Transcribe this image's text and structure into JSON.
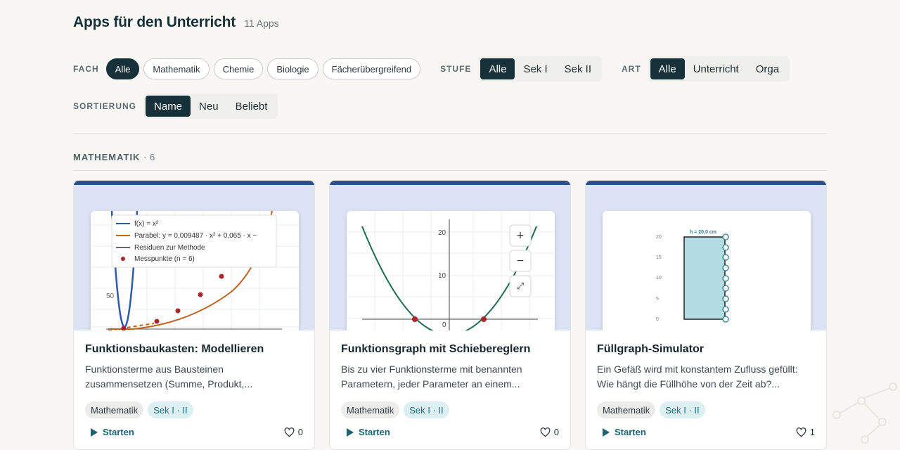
{
  "header": {
    "title": "Apps für den Unterricht",
    "count": "11 Apps"
  },
  "filters": {
    "fach": {
      "label": "FACH",
      "options": [
        "Alle",
        "Mathematik",
        "Chemie",
        "Biologie",
        "Fächerübergreifend"
      ],
      "selected": "Alle"
    },
    "stufe": {
      "label": "STUFE",
      "options": [
        "Alle",
        "Sek I",
        "Sek II"
      ],
      "selected": "Alle"
    },
    "art": {
      "label": "ART",
      "options": [
        "Alle",
        "Unterricht",
        "Orga"
      ],
      "selected": "Alle"
    },
    "sortierung": {
      "label": "SORTIERUNG",
      "options": [
        "Name",
        "Neu",
        "Beliebt"
      ],
      "selected": "Name"
    }
  },
  "section": {
    "title": "MATHEMATIK",
    "count": "· 6"
  },
  "cards": [
    {
      "title": "Funktionsbaukasten: Modellieren",
      "desc": "Funktionsterme aus Bausteinen zusammensetzen (Summe, Produkt,...",
      "subject": "Mathematik",
      "level": "Sek I · II",
      "start": "Starten",
      "likes": "0",
      "preview": {
        "legend": [
          "f(x) = x²",
          "Parabel: y = 0,009487 · x² + 0,065 · x −",
          "Residuen zur Methode",
          "Messpunkte (n = 6)"
        ],
        "y_tick": "50"
      }
    },
    {
      "title": "Funktionsgraph mit Schiebereglern",
      "desc": "Bis zu vier Funktionsterme mit benannten Parametern, jeder Parameter an einem...",
      "subject": "Mathematik",
      "level": "Sek I · II",
      "start": "Starten",
      "likes": "0",
      "preview": {
        "y_ticks": [
          "20",
          "10",
          "0"
        ],
        "zoom_in": "+",
        "zoom_out": "−",
        "fullscreen": "⤢"
      }
    },
    {
      "title": "Füllgraph-Simulator",
      "desc": "Ein Gefäß wird mit konstantem Zufluss gefüllt: Wie hängt die Füllhöhe von der Zeit ab?...",
      "subject": "Mathematik",
      "level": "Sek I · II",
      "start": "Starten",
      "likes": "1",
      "preview": {
        "height_label": "h = 20,0 cm",
        "ticks": [
          "20",
          "15",
          "10",
          "5",
          "0"
        ]
      }
    }
  ],
  "colors": {
    "accent": "#16313a",
    "card_top": "#2e4f8d",
    "preview_bg": "#dce3f4",
    "level_tag": "#1f6f80"
  }
}
